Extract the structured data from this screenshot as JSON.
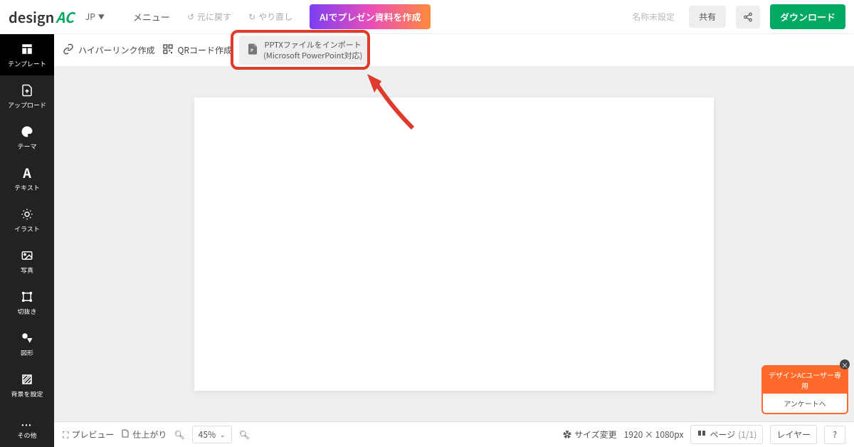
{
  "logo": {
    "text": "design",
    "suffix": "AC"
  },
  "lang": "JP",
  "topbar": {
    "menu": "メニュー",
    "undo": "元に戻す",
    "redo": "やり直し",
    "ai_button": "AIでプレゼン資料を作成",
    "name_unset": "名称未設定",
    "share": "共有",
    "download": "ダウンロード"
  },
  "toolbar2": {
    "hyperlink": "ハイパーリンク作成",
    "qrcode": "QRコード作成",
    "pptx_line1": "PPTXファイルをインポート",
    "pptx_line2": "(Microsoft PowerPoint対応)"
  },
  "sidebar": {
    "items": [
      {
        "label": "テンプレート",
        "icon": "template"
      },
      {
        "label": "アップロード",
        "icon": "upload"
      },
      {
        "label": "テーマ",
        "icon": "palette"
      },
      {
        "label": "テキスト",
        "icon": "text"
      },
      {
        "label": "イラスト",
        "icon": "sun"
      },
      {
        "label": "写真",
        "icon": "image"
      },
      {
        "label": "切抜き",
        "icon": "crop"
      },
      {
        "label": "図形",
        "icon": "shapes"
      },
      {
        "label": "背景を設定",
        "icon": "hatch"
      }
    ],
    "more": "その他"
  },
  "bottombar": {
    "preview": "プレビュー",
    "finish": "仕上がり",
    "zoom": "45%",
    "size_change": "サイズ変更",
    "dimensions": "1920 × 1080px",
    "page_label": "ページ",
    "page_count": "(1/1)",
    "layer": "レイヤー"
  },
  "survey": {
    "title": "デザインACユーザー専用",
    "body": "アンケートへ"
  }
}
